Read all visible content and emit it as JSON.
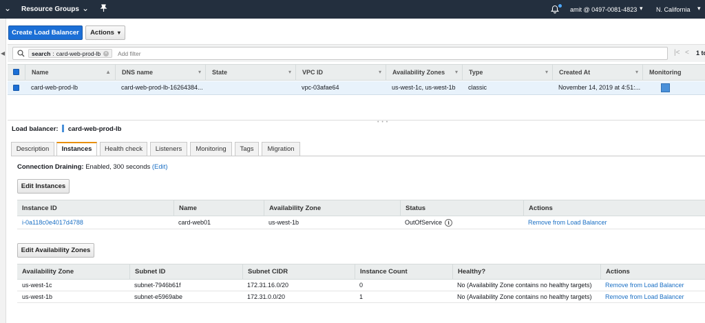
{
  "topnav": {
    "menu_caret": "⌄",
    "resource_groups": "Resource Groups",
    "account": "amit @ 0497-0081-4823",
    "region": "N. California"
  },
  "toolbar": {
    "create_label": "Create Load Balancer",
    "actions_label": "Actions"
  },
  "search": {
    "token_key": "search",
    "token_value": "card-web-prod-lb",
    "placeholder": "Add filter",
    "pagination": "1 to"
  },
  "grid": {
    "columns": [
      "Name",
      "DNS name",
      "State",
      "VPC ID",
      "Availability Zones",
      "Type",
      "Created At",
      "Monitoring"
    ],
    "rows": [
      {
        "name": "card-web-prod-lb",
        "dns": "card-web-prod-lb-16264384...",
        "state": "",
        "vpc": "vpc-03afae64",
        "zones": "us-west-1c, us-west-1b",
        "type": "classic",
        "created": "November 14, 2019 at 4:51:..."
      }
    ]
  },
  "details": {
    "title_label": "Load balancer:",
    "title_value": "card-web-prod-lb",
    "tabs": [
      "Description",
      "Instances",
      "Health check",
      "Listeners",
      "Monitoring",
      "Tags",
      "Migration"
    ],
    "active_tab": "Instances",
    "draining_label": "Connection Draining:",
    "draining_value": "Enabled, 300 seconds",
    "draining_edit": "(Edit)",
    "edit_instances_label": "Edit Instances",
    "instances": {
      "columns": [
        "Instance ID",
        "Name",
        "Availability Zone",
        "Status",
        "Actions"
      ],
      "rows": [
        {
          "id": "i-0a118c0e4017d4788",
          "name": "card-web01",
          "zone": "us-west-1b",
          "status": "OutOfService",
          "action": "Remove from Load Balancer"
        }
      ]
    },
    "edit_zones_label": "Edit Availability Zones",
    "zones": {
      "columns": [
        "Availability Zone",
        "Subnet ID",
        "Subnet CIDR",
        "Instance Count",
        "Healthy?",
        "Actions"
      ],
      "rows": [
        {
          "zone": "us-west-1c",
          "subnet": "subnet-7946b61f",
          "cidr": "172.31.16.0/20",
          "count": "0",
          "healthy": "No (Availability Zone contains no healthy targets)",
          "action": "Remove from Load Balancer"
        },
        {
          "zone": "us-west-1b",
          "subnet": "subnet-e5969abe",
          "cidr": "172.31.0.0/20",
          "count": "1",
          "healthy": "No (Availability Zone contains no healthy targets)",
          "action": "Remove from Load Balancer"
        }
      ]
    }
  },
  "colors": {
    "nav_bg": "#232f3e",
    "primary": "#1c6fd6",
    "link": "#1a6fc4",
    "active_tab": "#e88f0a",
    "selected_row": "#e8f2fb",
    "notification_dot": "#4ea9ff"
  }
}
